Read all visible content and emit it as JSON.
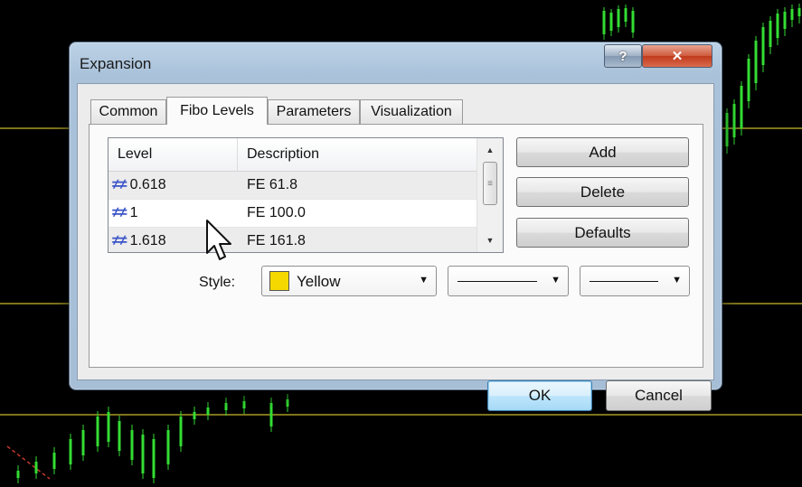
{
  "window": {
    "title": "Expansion",
    "help_label": "?",
    "close_label": "✕"
  },
  "tabs": [
    {
      "label": "Common",
      "active": false
    },
    {
      "label": "Fibo Levels",
      "active": true
    },
    {
      "label": "Parameters",
      "active": false
    },
    {
      "label": "Visualization",
      "active": false
    }
  ],
  "levels_list": {
    "columns": [
      "Level",
      "Description"
    ],
    "rows": [
      {
        "level": "0.618",
        "description": "FE 61.8"
      },
      {
        "level": "1",
        "description": "FE 100.0"
      },
      {
        "level": "1.618",
        "description": "FE 161.8"
      }
    ],
    "level_icon": "fibo-level-icon"
  },
  "buttons": {
    "add": "Add",
    "delete": "Delete",
    "defaults": "Defaults",
    "ok": "OK",
    "cancel": "Cancel"
  },
  "style": {
    "label": "Style:",
    "color_name": "Yellow",
    "color_hex": "#f5d800"
  },
  "colors": {
    "chart_background": "#000000",
    "chart_candles": "#33dd33",
    "chart_level_lines": "#b5a52a"
  }
}
